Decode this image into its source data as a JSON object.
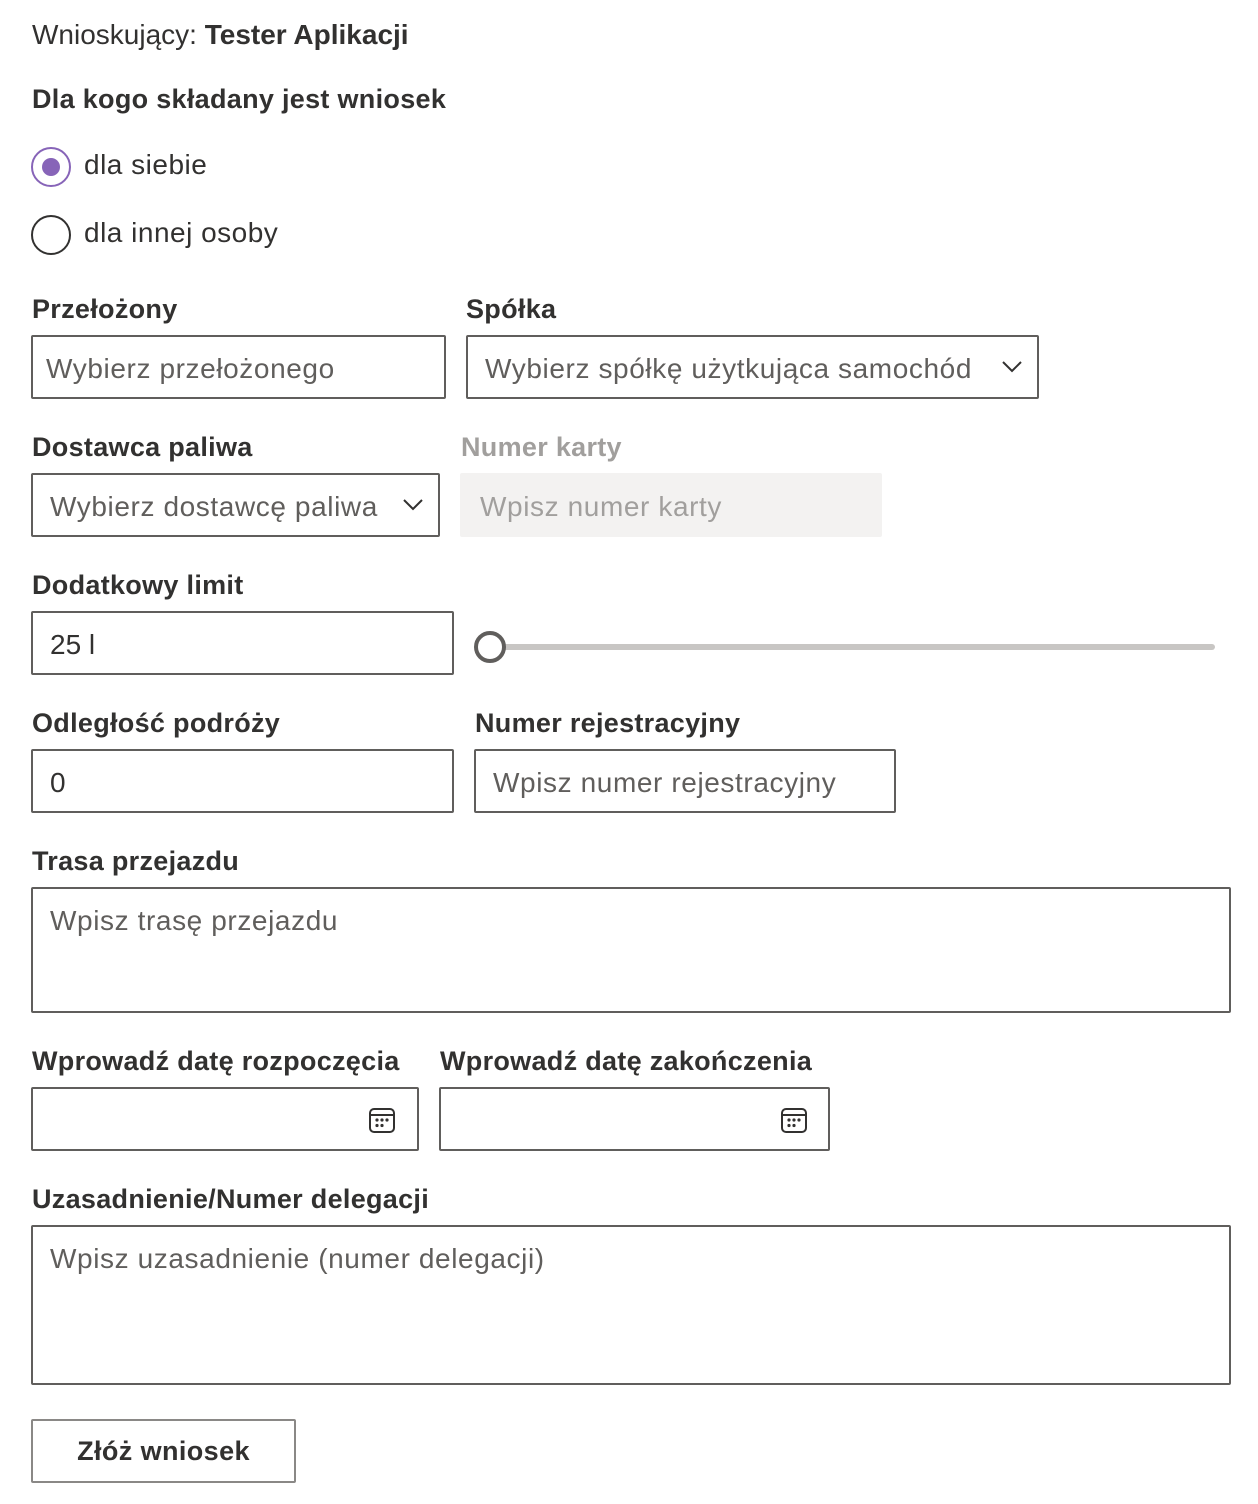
{
  "requester": {
    "label": "Wnioskujący:",
    "name": "Tester Aplikacji"
  },
  "for_whom": {
    "label": "Dla kogo składany jest wniosek",
    "options": [
      {
        "label": "dla siebie",
        "checked": true
      },
      {
        "label": "dla innej osoby",
        "checked": false
      }
    ]
  },
  "supervisor": {
    "label": "Przełożony",
    "placeholder": "Wybierz przełożonego"
  },
  "company": {
    "label": "Spółka",
    "placeholder": "Wybierz spółkę użytkująca samochód"
  },
  "fuel_supplier": {
    "label": "Dostawca paliwa",
    "placeholder": "Wybierz dostawcę paliwa"
  },
  "card_number": {
    "label": "Numer karty",
    "placeholder": "Wpisz numer karty",
    "disabled": true
  },
  "extra_limit": {
    "label": "Dodatkowy limit",
    "value": "25 l",
    "slider_fraction": 0.0
  },
  "distance": {
    "label": "Odległość podróży",
    "value": "0"
  },
  "registration": {
    "label": "Numer rejestracyjny",
    "placeholder": "Wpisz numer rejestracyjny"
  },
  "route": {
    "label": "Trasa przejazdu",
    "placeholder": "Wpisz trasę przejazdu"
  },
  "start_date": {
    "label": "Wprowadź datę rozpoczęcia",
    "value": ""
  },
  "end_date": {
    "label": "Wprowadź datę zakończenia",
    "value": ""
  },
  "justification": {
    "label": "Uzasadnienie/Numer delegacji",
    "placeholder": "Wpisz uzasadnienie (numer delegacji)"
  },
  "submit": {
    "label": "Złóż wniosek"
  },
  "colors": {
    "accent": "#8764b8",
    "border": "#605e5c",
    "disabled_bg": "#f3f2f1",
    "text": "#323130"
  },
  "icons": {
    "dropdown": "chevron-down-icon",
    "calendar": "calendar-icon"
  }
}
